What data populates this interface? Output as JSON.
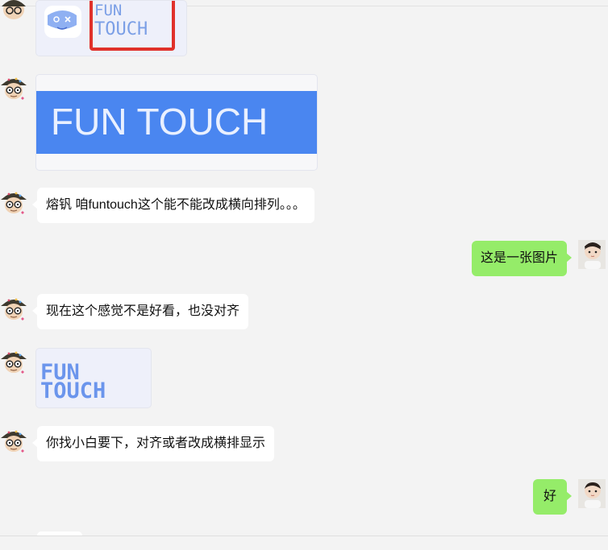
{
  "messages": [
    {
      "type": "image",
      "side": "left",
      "alt_text": "FUN TOUCH"
    },
    {
      "type": "image",
      "side": "left",
      "alt_text": "FUN TOUCH"
    },
    {
      "type": "text",
      "side": "left",
      "text": "熔钒 咱funtouch这个能不能改成横向排列。。。"
    },
    {
      "type": "text",
      "side": "right",
      "text": "这是一张图片"
    },
    {
      "type": "text",
      "side": "left",
      "text": "现在这个感觉不是好看，也没对齐"
    },
    {
      "type": "image",
      "side": "left",
      "alt_text": "FUN TOUCH"
    },
    {
      "type": "text",
      "side": "left",
      "text": "你找小白要下，对齐或者改成横排显示"
    },
    {
      "type": "text",
      "side": "right",
      "text": "好"
    }
  ],
  "images": {
    "logo_top": {
      "line1": "FUN",
      "line2": "TOUCH"
    },
    "banner": {
      "text": "FUN TOUCH"
    },
    "logo_small": {
      "line1": "FUN",
      "line2": "TOUCH"
    }
  },
  "colors": {
    "background": "#f3f3f3",
    "incoming_bubble": "#ffffff",
    "outgoing_bubble": "#95ec69",
    "banner_blue": "#4a86f0",
    "logo_blue": "#6b95ec",
    "highlight_red": "#e0312b"
  },
  "avatars": {
    "left_icon": "cartoon-man-bucket-hat-icon",
    "right_icon": "child-photo-icon"
  }
}
